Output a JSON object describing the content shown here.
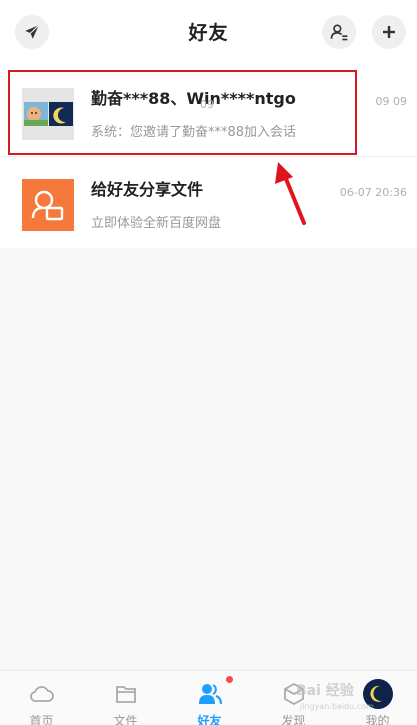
{
  "header": {
    "title": "好友"
  },
  "conversations": [
    {
      "name": "勤奋***88、Win****ntgo",
      "preview": "系统：您邀请了勤奋***88加入会话",
      "time": "09 09"
    },
    {
      "name": "给好友分享文件",
      "preview": "立即体验全新百度网盘",
      "time": "06-07 20:36",
      "time_extra": "09"
    }
  ],
  "tabs": [
    {
      "label": "首页",
      "icon": "cloud-icon"
    },
    {
      "label": "文件",
      "icon": "folder-icon"
    },
    {
      "label": "好友",
      "icon": "friends-icon"
    },
    {
      "label": "发现",
      "icon": "discover-icon"
    },
    {
      "label": "我的",
      "icon": "avatar"
    }
  ],
  "watermark": {
    "line1": "Bai 经验",
    "line2": "jingyan.baidu.com"
  },
  "colors": {
    "accent": "#1e9fff",
    "highlight": "#d11a22",
    "share_icon_bg": "#f5793b",
    "badge": "#f24e4e"
  }
}
